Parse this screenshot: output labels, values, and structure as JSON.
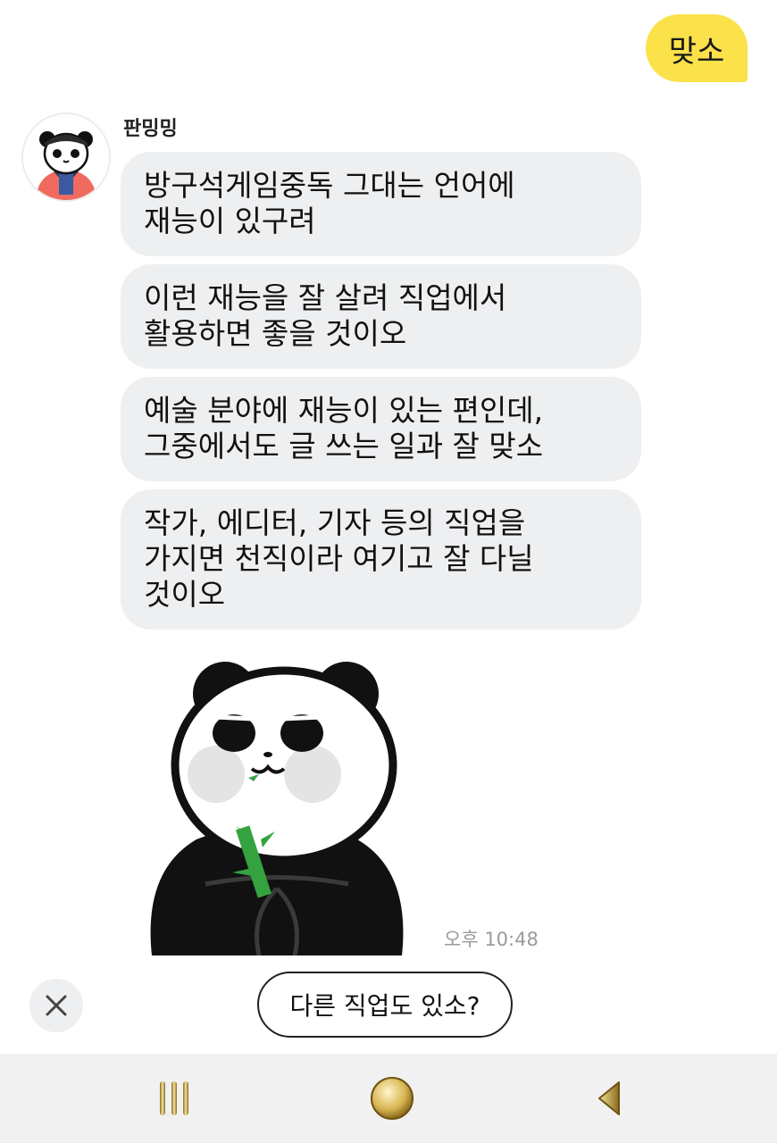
{
  "sent_message": {
    "text": "맞소"
  },
  "sender": {
    "name": "판밍밍"
  },
  "messages": [
    {
      "text": "방구석게임중독 그대는 언어에\n재능이 있구려"
    },
    {
      "text": "이런 재능을 잘 살려 직업에서\n활용하면 좋을 것이오"
    },
    {
      "text": "예술 분야에 재능이 있는 편인데,\n그중에서도 글 쓰는 일과 잘 맞소"
    },
    {
      "text": "작가, 에디터, 기자 등의 직업을\n가지면 천직이라 여기고 잘 다닐\n것이오"
    }
  ],
  "timestamp": "오후 10:48",
  "quick_reply": {
    "label": "다른 직업도 있소?"
  },
  "colors": {
    "sent_bubble": "#fbe14a",
    "received_bubble": "#eeeff1",
    "timestamp": "#9a9a9a",
    "navbar": "#f1f1f1"
  },
  "icons": {
    "close": "close-icon",
    "recent_apps": "recent-apps-icon",
    "home": "home-icon",
    "back": "back-icon"
  }
}
